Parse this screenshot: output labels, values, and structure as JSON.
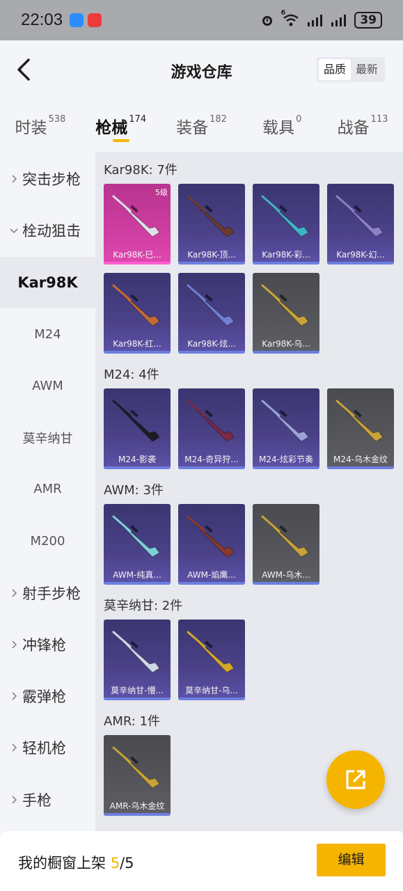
{
  "status_bar": {
    "time": "22:03",
    "battery": "39",
    "icons": [
      "message-app-icon",
      "red-app-icon",
      "alarm-icon",
      "wifi-6-icon",
      "signal-icon",
      "signal-icon",
      "battery-icon"
    ],
    "network_tag": "6"
  },
  "header": {
    "title": "游戏仓库",
    "sort_options": [
      "品质",
      "最新"
    ],
    "sort_selected": "品质"
  },
  "tabs": [
    {
      "label": "时装",
      "count": "538"
    },
    {
      "label": "枪械",
      "count": "174",
      "active": true
    },
    {
      "label": "装备",
      "count": "182"
    },
    {
      "label": "载具",
      "count": "0"
    },
    {
      "label": "战备",
      "count": "113"
    }
  ],
  "sidebar": {
    "items": [
      {
        "label": "突击步枪",
        "type": "category",
        "expanded": false
      },
      {
        "label": "栓动狙击",
        "type": "category",
        "expanded": true
      },
      {
        "label": "Kar98K",
        "type": "sub",
        "selected": true
      },
      {
        "label": "M24",
        "type": "sub"
      },
      {
        "label": "AWM",
        "type": "sub"
      },
      {
        "label": "莫辛纳甘",
        "type": "sub"
      },
      {
        "label": "AMR",
        "type": "sub"
      },
      {
        "label": "M200",
        "type": "sub"
      },
      {
        "label": "射手步枪",
        "type": "category",
        "expanded": false
      },
      {
        "label": "冲锋枪",
        "type": "category",
        "expanded": false
      },
      {
        "label": "霰弹枪",
        "type": "category",
        "expanded": false
      },
      {
        "label": "轻机枪",
        "type": "category",
        "expanded": false
      },
      {
        "label": "手枪",
        "type": "category",
        "expanded": false
      }
    ]
  },
  "groups": [
    {
      "title": "Kar98K: 7件",
      "items": [
        {
          "label": "Kar98K-巳...",
          "rarity": "pink",
          "badge": "5级",
          "gun": "#e0e0e8"
        },
        {
          "label": "Kar98K-顶...",
          "rarity": "purple",
          "gun": "#6b3c2e"
        },
        {
          "label": "Kar98K-彩...",
          "rarity": "purple",
          "gun": "#3fb3c6"
        },
        {
          "label": "Kar98K-幻...",
          "rarity": "purple",
          "gun": "#8c7fc6"
        },
        {
          "label": "Kar98K-红...",
          "rarity": "purple",
          "gun": "#c56a36"
        },
        {
          "label": "Kar98K-炫...",
          "rarity": "purple",
          "gun": "#6f7fd2"
        },
        {
          "label": "Kar98K-乌...",
          "rarity": "grey",
          "gun": "#c9a23a"
        }
      ]
    },
    {
      "title": "M24: 4件",
      "items": [
        {
          "label": "M24-影袭",
          "rarity": "purple",
          "gun": "#1c1c24"
        },
        {
          "label": "M24-奇异狩...",
          "rarity": "purple",
          "gun": "#7a2a44"
        },
        {
          "label": "M24-炫彩节奏",
          "rarity": "purple",
          "gun": "#9aa3d8"
        },
        {
          "label": "M24-乌木金纹",
          "rarity": "grey",
          "gun": "#c9a23a"
        }
      ]
    },
    {
      "title": "AWM: 3件",
      "items": [
        {
          "label": "AWM-纯真...",
          "rarity": "purple",
          "gun": "#7ecfd8"
        },
        {
          "label": "AWM-焰鹰...",
          "rarity": "purple",
          "gun": "#8a3a2a"
        },
        {
          "label": "AWM-乌木...",
          "rarity": "grey",
          "gun": "#c9a23a"
        }
      ]
    },
    {
      "title": "莫辛纳甘: 2件",
      "items": [
        {
          "label": "莫辛纳甘-懵...",
          "rarity": "purple",
          "gun": "#cfd8e6"
        },
        {
          "label": "莫辛纳甘-乌...",
          "rarity": "purple",
          "gun": "#d4a72a"
        }
      ]
    },
    {
      "title": "AMR: 1件",
      "items": [
        {
          "label": "AMR-乌木金纹",
          "rarity": "grey",
          "gun": "#c9a23a"
        }
      ]
    }
  ],
  "fab": {
    "icon": "share-external-icon"
  },
  "bottom_bar": {
    "showcase_label": "我的橱窗上架",
    "showcase_current": "5",
    "showcase_total": "/5",
    "edit_label": "编辑"
  },
  "colors": {
    "accent": "#f5b400",
    "card_purple": "#4b4188",
    "card_pink": "#cf3ea1",
    "card_grey": "#55565b"
  }
}
